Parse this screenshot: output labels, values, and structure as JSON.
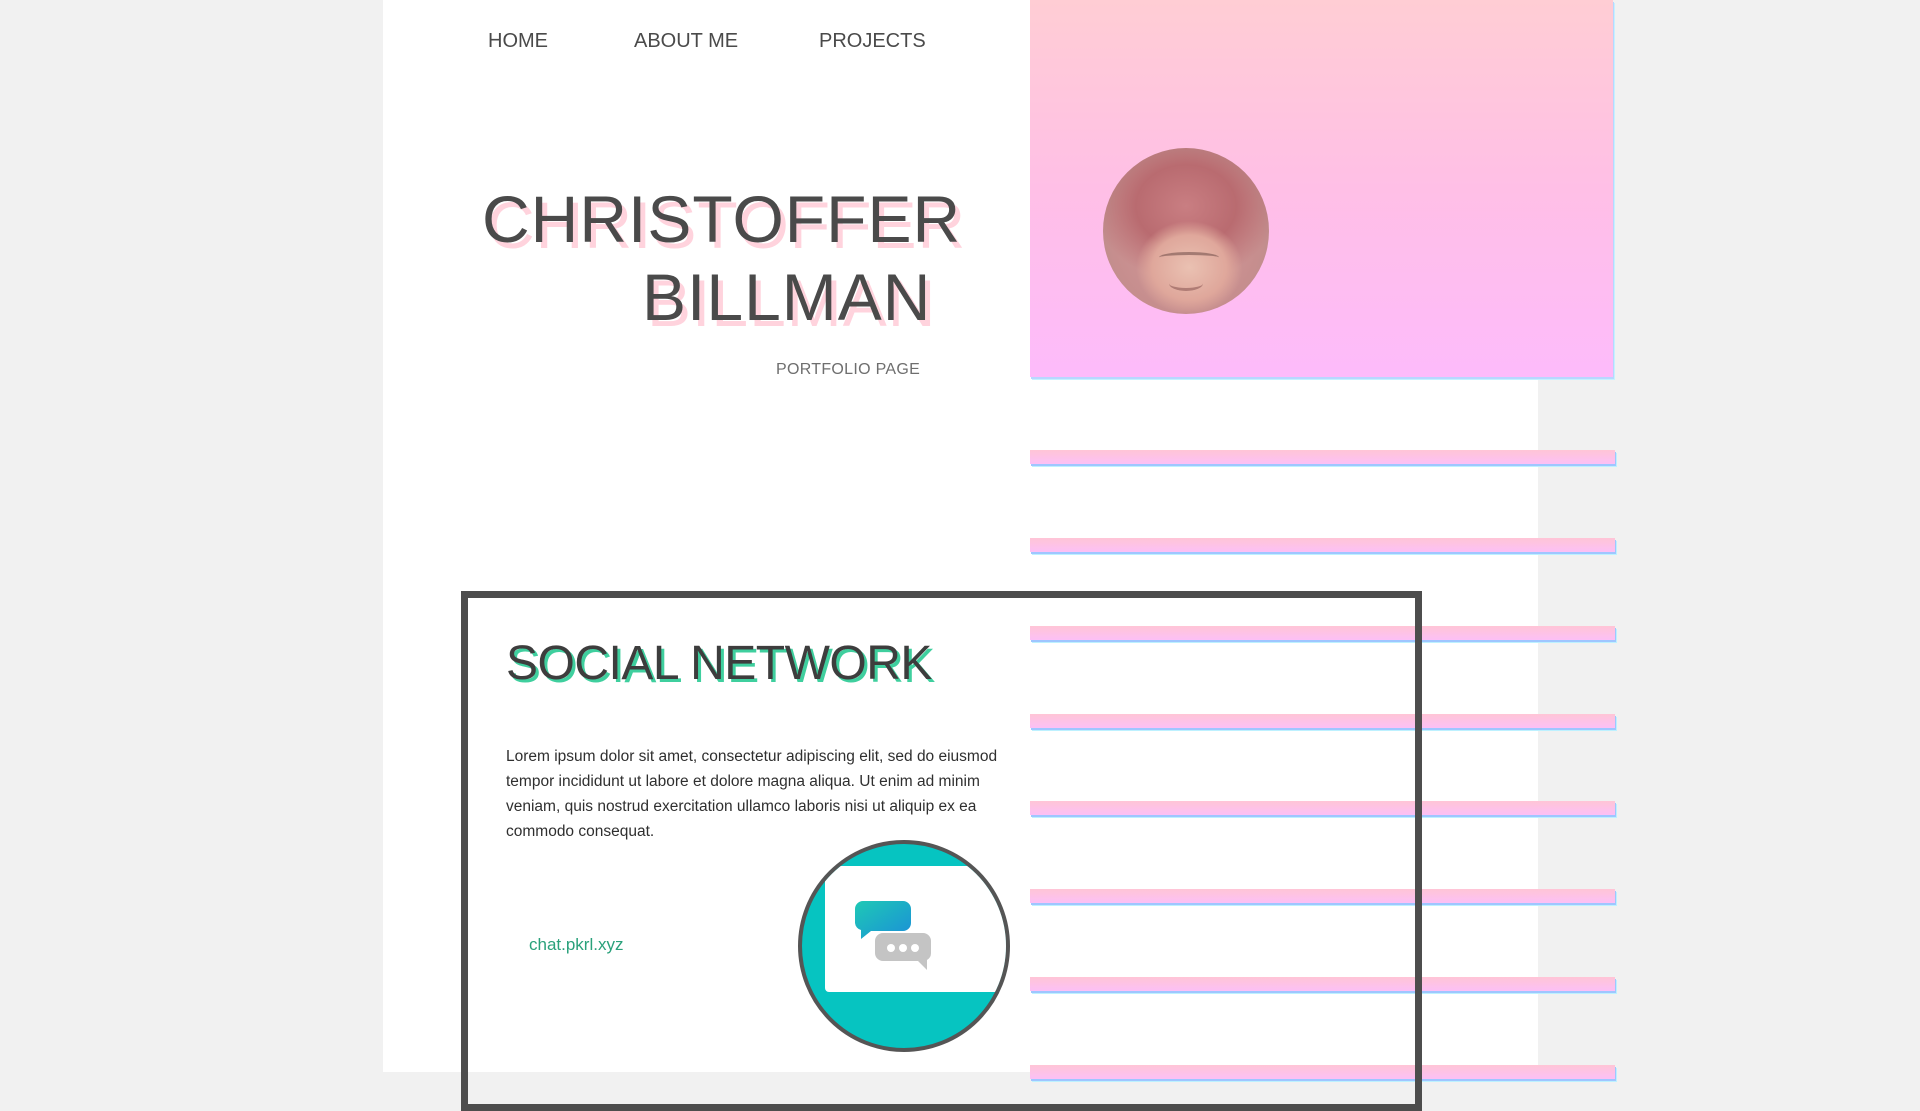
{
  "nav": {
    "items": [
      {
        "label": "HOME"
      },
      {
        "label": "ABOUT ME"
      },
      {
        "label": "PROJECTS"
      }
    ]
  },
  "hero": {
    "name_line1": "CHRISTOFFER",
    "name_line2": "BILLMAN",
    "subtitle": "PORTFOLIO PAGE",
    "avatar_icon": "profile-photo",
    "gradient_colors": [
      "#ffcdd4",
      "#fdbbfb"
    ]
  },
  "project": {
    "title": "SOCIAL NETWORK",
    "description": "Lorem ipsum dolor sit amet, consectetur adipiscing elit, sed do eiusmod tempor incididunt ut labore et dolore magna aliqua. Ut enim ad minim veniam, quis nostrud exercitation ullamco laboris nisi ut aliquip ex ea commodo consequat.",
    "link": "chat.pkrl.xyz",
    "preview_icon": "chat-bubbles-icon",
    "accent_color": "#06c4c1",
    "title_shadow_color": "#3fcf9e"
  }
}
